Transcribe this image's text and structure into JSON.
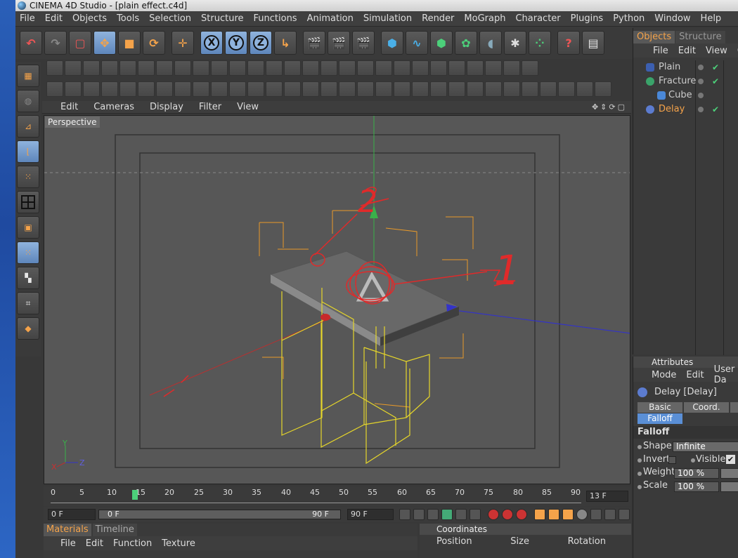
{
  "window": {
    "title": "CINEMA 4D Studio - [plain effect.c4d]"
  },
  "menubar": [
    "File",
    "Edit",
    "Objects",
    "Tools",
    "Selection",
    "Structure",
    "Functions",
    "Animation",
    "Simulation",
    "Render",
    "MoGraph",
    "Character",
    "Plugins",
    "Python",
    "Window",
    "Help"
  ],
  "toolbar": {
    "x_label": "X",
    "y_label": "Y",
    "z_label": "Z"
  },
  "viewport": {
    "menu": [
      "Edit",
      "Cameras",
      "Display",
      "Filter",
      "View"
    ],
    "label": "Perspective",
    "axis_x": "X",
    "axis_y": "Y",
    "axis_z": "Z"
  },
  "annotations": {
    "one": "1",
    "two": "2"
  },
  "timeline": {
    "ticks": [
      "0",
      "5",
      "10",
      "15",
      "20",
      "25",
      "30",
      "35",
      "40",
      "45",
      "50",
      "55",
      "60",
      "65",
      "70",
      "75",
      "80",
      "85",
      "90"
    ],
    "current_frame": "13 F",
    "start": "0 F",
    "range_start": "0 F",
    "range_end": "90 F",
    "end": "90 F"
  },
  "materials": {
    "tabs": [
      "Materials",
      "Timeline"
    ],
    "menu": [
      "File",
      "Edit",
      "Function",
      "Texture"
    ]
  },
  "coordinates": {
    "title": "Coordinates",
    "cols": [
      "Position",
      "Size",
      "Rotation"
    ]
  },
  "objects": {
    "tabs": [
      "Objects",
      "Structure"
    ],
    "menu": [
      "File",
      "Edit",
      "View",
      "Ob"
    ],
    "rows": [
      {
        "name": "Plain",
        "color": "#3c5fb0"
      },
      {
        "name": "Fracture",
        "color": "#3aa36a"
      },
      {
        "name": "Cube",
        "color": "#4a88d8"
      },
      {
        "name": "Delay",
        "color": "#5c7cd0"
      }
    ]
  },
  "attributes": {
    "title": "Attributes",
    "menu": [
      "Mode",
      "Edit",
      "User Da"
    ],
    "object_label": "Delay [Delay]",
    "tabs": [
      "Basic",
      "Coord.",
      "Falloff"
    ],
    "section": "Falloff",
    "shape_label": "Shape",
    "shape_value": "Infinite",
    "invert_label": "Invert",
    "visible_label": "Visible",
    "weight_label": "Weight",
    "weight_value": "100 %",
    "scale_label": "Scale",
    "scale_value": "100 %"
  }
}
